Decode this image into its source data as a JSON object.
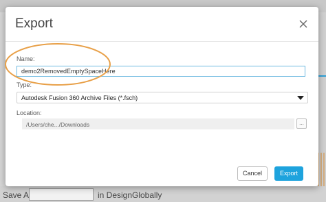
{
  "background": {
    "bottom_left_label": "Save As:",
    "bottom_mid_label": "in Design",
    "bottom_right_label": "Globally"
  },
  "dialog": {
    "title": "Export",
    "name_label": "Name:",
    "name_value": "demo2RemovedEmptySpaceHere",
    "type_label": "Type:",
    "type_value": "Autodesk Fusion 360 Archive Files (*.fsch)",
    "location_label": "Location:",
    "location_value": "/Users/che.../Downloads",
    "browse_label": "...",
    "cancel_label": "Cancel",
    "export_label": "Export"
  },
  "colors": {
    "accent": "#1ea3dd",
    "annotation": "#e8a048"
  },
  "icons": {
    "close": "close-icon",
    "dropdown": "caret-down-icon"
  }
}
